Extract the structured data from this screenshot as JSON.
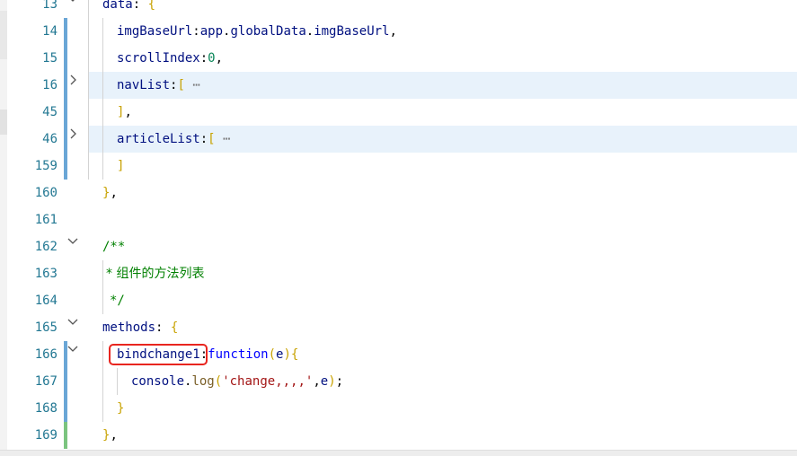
{
  "editor": {
    "lines": [
      {
        "num": "13",
        "fold": "open",
        "segments": [
          [
            "obj",
            "data"
          ],
          [
            "punc",
            ": "
          ],
          [
            "brace",
            "{"
          ]
        ]
      },
      {
        "num": "14",
        "segments": [
          [
            "obj",
            "imgBaseUrl"
          ],
          [
            "punc",
            ":"
          ],
          [
            "obj",
            "app"
          ],
          [
            "punc",
            "."
          ],
          [
            "obj",
            "globalData"
          ],
          [
            "punc",
            "."
          ],
          [
            "obj",
            "imgBaseUrl"
          ],
          [
            "punc",
            ","
          ]
        ]
      },
      {
        "num": "15",
        "segments": [
          [
            "obj",
            "scrollIndex"
          ],
          [
            "punc",
            ":"
          ],
          [
            "num",
            "0"
          ],
          [
            "punc",
            ","
          ]
        ]
      },
      {
        "num": "16",
        "fold": "closed",
        "segments": [
          [
            "obj",
            "navList"
          ],
          [
            "punc",
            ":"
          ],
          [
            "brace",
            "["
          ],
          [
            "ell",
            " ⋯"
          ]
        ]
      },
      {
        "num": "45",
        "segments": [
          [
            "brace",
            "]"
          ],
          [
            "punc",
            ","
          ]
        ]
      },
      {
        "num": "46",
        "fold": "closed",
        "segments": [
          [
            "obj",
            "articleList"
          ],
          [
            "punc",
            ":"
          ],
          [
            "brace",
            "["
          ],
          [
            "ell",
            " ⋯"
          ]
        ]
      },
      {
        "num": "159",
        "segments": [
          [
            "brace",
            "]"
          ]
        ]
      },
      {
        "num": "160",
        "segments": [
          [
            "brace",
            "}"
          ],
          [
            "punc",
            ","
          ]
        ]
      },
      {
        "num": "161",
        "segments": []
      },
      {
        "num": "162",
        "fold": "open",
        "segments": [
          [
            "cmt",
            "/**"
          ]
        ]
      },
      {
        "num": "163",
        "segments": [
          [
            "cmt",
            "* 组件的方法列表"
          ]
        ]
      },
      {
        "num": "164",
        "segments": [
          [
            "cmt",
            "*/"
          ]
        ]
      },
      {
        "num": "165",
        "fold": "open",
        "segments": [
          [
            "obj",
            "methods"
          ],
          [
            "punc",
            ": "
          ],
          [
            "brace",
            "{"
          ]
        ]
      },
      {
        "num": "166",
        "fold": "open",
        "segments": [
          [
            "obj",
            "bindchange1"
          ],
          [
            "punc",
            ":"
          ],
          [
            "cfn",
            "function"
          ],
          [
            "paren",
            "("
          ],
          [
            "obj",
            "e"
          ],
          [
            "paren",
            ")"
          ],
          [
            "brace",
            "{"
          ]
        ]
      },
      {
        "num": "167",
        "segments": [
          [
            "obj",
            "console"
          ],
          [
            "punc",
            "."
          ],
          [
            "fn",
            "log"
          ],
          [
            "paren",
            "("
          ],
          [
            "str",
            "'change,,,,'"
          ],
          [
            "punc",
            ","
          ],
          [
            "obj",
            "e"
          ],
          [
            "paren",
            ")"
          ],
          [
            "punc",
            ";"
          ]
        ]
      },
      {
        "num": "168",
        "segments": [
          [
            "brace",
            "}"
          ]
        ]
      },
      {
        "num": "169",
        "segments": [
          [
            "brace",
            "}"
          ],
          [
            "punc",
            ","
          ]
        ]
      }
    ]
  }
}
